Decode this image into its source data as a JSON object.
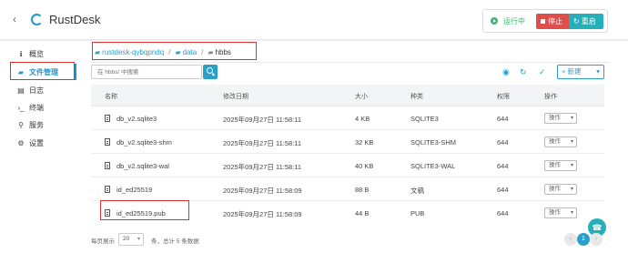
{
  "header": {
    "back_icon": "chevron-left-icon",
    "logo_icon": "rustdesk-logo-icon",
    "title": "RustDesk",
    "status": "运行中",
    "stop_label": "停止",
    "restart_label": "重启"
  },
  "sidebar": {
    "items": [
      {
        "icon": "info-icon",
        "glyph": "ℹ",
        "label": "概览"
      },
      {
        "icon": "folder-icon",
        "glyph": "▰",
        "label": "文件管理"
      },
      {
        "icon": "file-text-icon",
        "glyph": "▤",
        "label": "日志"
      },
      {
        "icon": "terminal-icon",
        "glyph": "›_",
        "label": "终端"
      },
      {
        "icon": "share-nodes-icon",
        "glyph": "⚲",
        "label": "服务"
      },
      {
        "icon": "gear-icon",
        "glyph": "⚙",
        "label": "设置"
      }
    ]
  },
  "breadcrumb": {
    "items": [
      "rustdesk-qybqpndq",
      "data",
      "hbbs"
    ]
  },
  "toolbar": {
    "search_placeholder": "在 hbbs/ 中搜索",
    "new_label": "新建"
  },
  "table": {
    "columns": [
      "名称",
      "修改日期",
      "大小",
      "种类",
      "权限",
      "操作"
    ],
    "rows": [
      {
        "name": "db_v2.sqlite3",
        "date": "2025年09月27日 11:58:11",
        "size": "4 KB",
        "kind": "SQLITE3",
        "perm": "644",
        "op": "操作"
      },
      {
        "name": "db_v2.sqlite3-shm",
        "date": "2025年09月27日 11:58:11",
        "size": "32 KB",
        "kind": "SQLITE3-SHM",
        "perm": "644",
        "op": "操作"
      },
      {
        "name": "db_v2.sqlite3-wal",
        "date": "2025年09月27日 11:58:11",
        "size": "40 KB",
        "kind": "SQLITE3-WAL",
        "perm": "644",
        "op": "操作"
      },
      {
        "name": "id_ed25519",
        "date": "2025年09月27日 11:58:09",
        "size": "88 B",
        "kind": "文稿",
        "perm": "644",
        "op": "操作"
      },
      {
        "name": "id_ed25519.pub",
        "date": "2025年09月27日 11:58:09",
        "size": "44 B",
        "kind": "PUB",
        "perm": "644",
        "op": "操作"
      }
    ]
  },
  "footer": {
    "per_page_label": "每页展示",
    "page_size": "20",
    "total_text": "条，总计 5 条数据",
    "current_page": "1",
    "prev": "‹",
    "next": "›"
  },
  "support_icon": "headset-icon",
  "colors": {
    "accent": "#2aa0c9",
    "stop": "#e04d4d",
    "restart": "#25b0b9",
    "running": "#3cb371",
    "annotation": "#e0302d"
  }
}
